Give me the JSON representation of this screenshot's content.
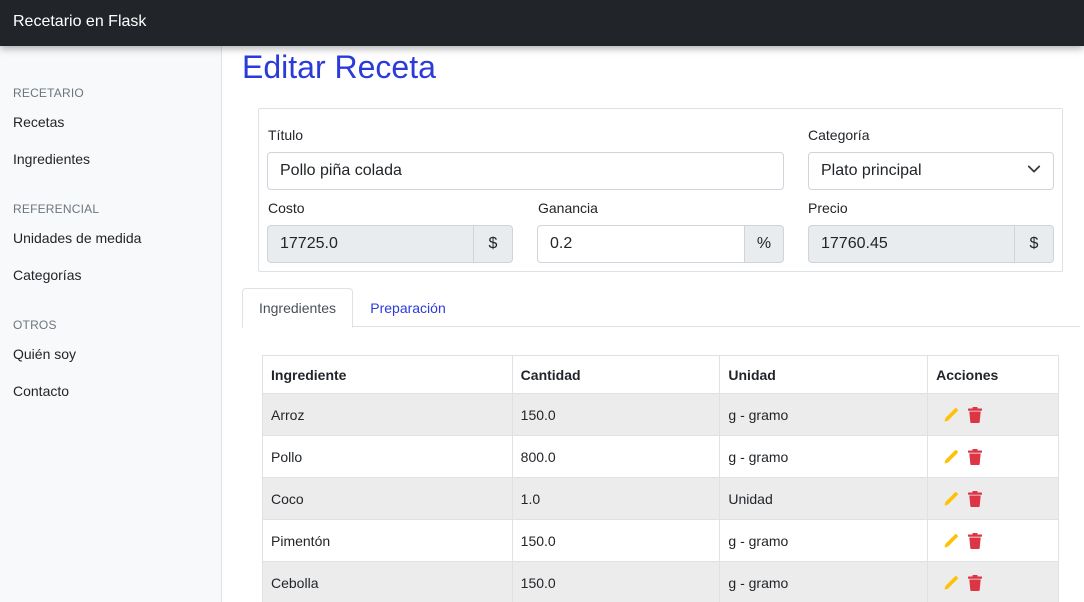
{
  "navbar": {
    "brand": "Recetario en Flask"
  },
  "sidebar": {
    "sections": [
      {
        "heading": "RECETARIO",
        "items": [
          "Recetas",
          "Ingredientes"
        ]
      },
      {
        "heading": "REFERENCIAL",
        "items": [
          "Unidades de medida",
          "Categorías"
        ]
      },
      {
        "heading": "OTROS",
        "items": [
          "Quién soy",
          "Contacto"
        ]
      }
    ]
  },
  "page": {
    "title": "Editar Receta"
  },
  "form": {
    "titulo_label": "Título",
    "titulo_value": "Pollo piña colada",
    "categoria_label": "Categoría",
    "categoria_value": "Plato principal",
    "costo_label": "Costo",
    "costo_value": "17725.0",
    "costo_addon": "$",
    "ganancia_label": "Ganancia",
    "ganancia_value": "0.2",
    "ganancia_addon": "%",
    "precio_label": "Precio",
    "precio_value": "17760.45",
    "precio_addon": "$"
  },
  "tabs": [
    {
      "label": "Ingredientes",
      "active": true
    },
    {
      "label": "Preparación",
      "active": false
    }
  ],
  "table": {
    "headers": [
      "Ingrediente",
      "Cantidad",
      "Unidad",
      "Acciones"
    ],
    "rows": [
      [
        "Arroz",
        "150.0",
        "g - gramo"
      ],
      [
        "Pollo",
        "800.0",
        "g - gramo"
      ],
      [
        "Coco",
        "1.0",
        "Unidad"
      ],
      [
        "Pimentón",
        "150.0",
        "g - gramo"
      ],
      [
        "Cebolla",
        "150.0",
        "g - gramo"
      ]
    ],
    "edit_icon": "pencil-icon",
    "delete_icon": "trash-icon",
    "edit_color": "#ffc107",
    "delete_color": "#dc3545"
  },
  "colors": {
    "accent": "#2b3bd9",
    "navbar": "#212529"
  }
}
